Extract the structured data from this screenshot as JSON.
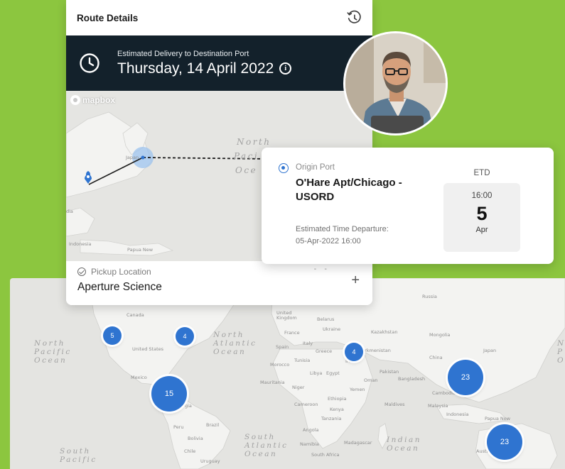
{
  "route_card": {
    "title": "Route Details",
    "eta_label": "Estimated Delivery to Destination Port",
    "eta_date": "Thursday, 14 April 2022",
    "info_glyph": "i",
    "icons": {
      "history": "history-icon",
      "clock": "clock-icon",
      "info": "info-icon"
    }
  },
  "mini_map": {
    "attribution": "mapbox",
    "labels": {
      "japan": "Japan",
      "india": "dia",
      "indonesia": "Indonesia",
      "papua": "Papua New",
      "ocean_n": "North",
      "ocean_p": "Paci",
      "ocean_o": "Oce"
    }
  },
  "pickup": {
    "label": "Pickup Location",
    "value": "Aperture Science",
    "add_glyph": "+",
    "dash": "- -"
  },
  "origin_port": {
    "label": "Origin Port",
    "name": "O'Hare Apt/Chicago - USORD",
    "etd_label": "ETD",
    "time": "16:00",
    "day": "5",
    "month": "Apr",
    "est_label": "Estimated Time Departure:",
    "est_value": "05-Apr-2022 16:00"
  },
  "world_map": {
    "countries": {
      "canada": "Canada",
      "united_states": "United States",
      "mexico": "Mexico",
      "peru": "Peru",
      "brazil": "Brazil",
      "bolivia": "Bolivia",
      "chile": "Chile",
      "uruguay": "Uruguay",
      "united_kingdom": "United Kingdom",
      "belarus": "Belarus",
      "ukraine": "Ukraine",
      "france": "France",
      "spain": "Spain",
      "italy": "Italy",
      "greece": "Greece",
      "tunisia": "Tunisia",
      "morocco": "Morocco",
      "libya": "Libya",
      "egypt": "Egypt",
      "mauritania": "Mauritania",
      "niger": "Niger",
      "cameroon": "Cameroon",
      "ethiopia": "Ethiopia",
      "kenya": "Kenya",
      "tanzania": "Tanzania",
      "angola": "Angola",
      "namibia": "Namibia",
      "south_africa": "South Africa",
      "madagascar": "Madagascar",
      "yemen": "Yemen",
      "oman": "Oman",
      "iran": "Iran",
      "turkmenistan": "Turkmenistan",
      "kazakhstan": "Kazakhstan",
      "russia": "Russia",
      "mongolia": "Mongolia",
      "china": "China",
      "japan": "Japan",
      "pakistan": "Pakistan",
      "bangladesh": "Bangladesh",
      "maldives": "Maldives",
      "cambodia": "Cambodia",
      "malaysia": "Malaysia",
      "indonesia": "Indonesia",
      "papua_new": "Papua New",
      "australia": "Austr",
      "gia": "gia"
    },
    "oceans": {
      "north_pacific": "North\nPacific\nOcean",
      "north_atlantic": "North\nAtlantic\nOcean",
      "south_atlantic": "South\nAtlantic\nOcean",
      "south_pacific": "South\nPacific",
      "indian": "Indian\nOcean",
      "right_edge": "N\nP\nO"
    },
    "clusters": [
      {
        "count": "5"
      },
      {
        "count": "4"
      },
      {
        "count": "15"
      },
      {
        "count": "4"
      },
      {
        "count": "23"
      },
      {
        "count": "23"
      }
    ]
  },
  "colors": {
    "background": "#8cc63f",
    "eta_bar": "#13212b",
    "accent": "#2f74d0"
  }
}
